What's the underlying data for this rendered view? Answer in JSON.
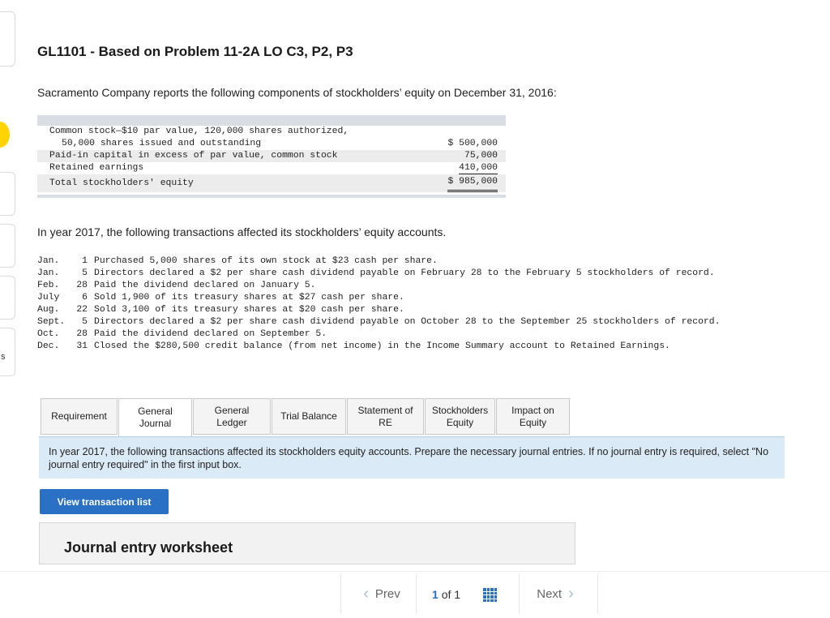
{
  "title": "GL1101 - Based on Problem 11-2A LO C3, P2, P3",
  "intro": "Sacramento Company reports the following components of stockholders’ equity on December 31, 2016:",
  "equity_table": {
    "row1_line1": "Common stock—$10 par value, 120,000 shares authorized,",
    "row1_line2": "50,000 shares issued and outstanding",
    "row1_amount": "$ 500,000",
    "row2_label": "Paid-in capital in excess of par value, common stock",
    "row2_amount": "75,000",
    "row3_label": "Retained earnings",
    "row3_amount": "410,000",
    "total_label": "Total stockholders' equity",
    "total_amount": "$ 985,000"
  },
  "year_text": "In year 2017, the following transactions affected its stockholders’ equity accounts.",
  "transactions": [
    {
      "month": "Jan.",
      "day": "1",
      "text": "Purchased 5,000 shares of its own stock at $23 cash per share."
    },
    {
      "month": "Jan.",
      "day": "5",
      "text": "Directors declared a $2 per share cash dividend payable on February 28 to the February 5 stockholders of record."
    },
    {
      "month": "Feb.",
      "day": "28",
      "text": "Paid the dividend declared on January 5."
    },
    {
      "month": "July",
      "day": "6",
      "text": "Sold 1,900 of its treasury shares at $27 cash per share."
    },
    {
      "month": "Aug.",
      "day": "22",
      "text": "Sold 3,100 of its treasury shares at $20 cash per share."
    },
    {
      "month": "Sept.",
      "day": "5",
      "text": "Directors declared a $2 per share cash dividend payable on October 28 to the September 25 stockholders of record."
    },
    {
      "month": "Oct.",
      "day": "28",
      "text": "Paid the dividend declared on September 5."
    },
    {
      "month": "Dec.",
      "day": "31",
      "text": "Closed the $280,500 credit balance (from net income) in the Income Summary account to Retained Earnings."
    }
  ],
  "tabs": [
    {
      "line1": "Requirement",
      "line2": ""
    },
    {
      "line1": "General",
      "line2": "Journal"
    },
    {
      "line1": "General",
      "line2": "Ledger"
    },
    {
      "line1": "Trial Balance",
      "line2": ""
    },
    {
      "line1": "Statement of",
      "line2": "RE"
    },
    {
      "line1": "Stockholders",
      "line2": "Equity"
    },
    {
      "line1": "Impact on",
      "line2": "Equity"
    }
  ],
  "active_tab": "General Journal",
  "instructions": "In year 2017, the following transactions affected its stockholders equity accounts.  Prepare the necessary journal entries.  If no journal entry is required, select \"No journal entry required\" in the first input box.",
  "view_button": "View transaction list",
  "worksheet_title": "Journal entry worksheet",
  "nav": {
    "prev": "Prev",
    "page_current": "1",
    "page_of": "of",
    "page_total": "1",
    "next": "Next"
  },
  "edge_text": "s",
  "colors": {
    "accent": "#2a70c4",
    "panel": "#daeaf7",
    "band": "#d9dde4",
    "highlight": "#ffd400"
  }
}
